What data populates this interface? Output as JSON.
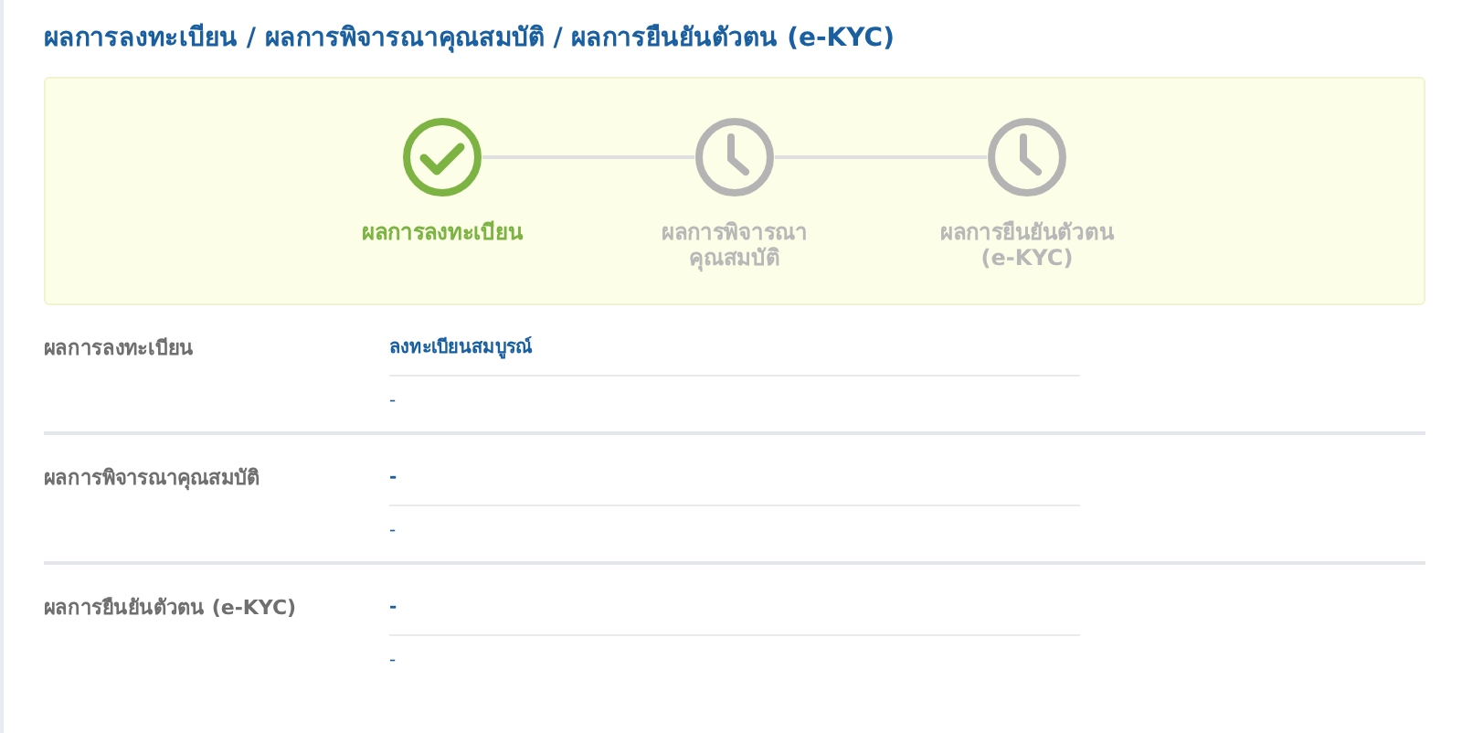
{
  "title": "ผลการลงทะเบียน / ผลการพิจารณาคุณสมบัติ / ผลการยืนยันตัวตน (e-KYC)",
  "steps": [
    {
      "label": "ผลการลงทะเบียน",
      "completed": true
    },
    {
      "label": "ผลการพิจารณา\nคุณสมบัติ",
      "completed": false
    },
    {
      "label": "ผลการยืนยันตัวตน\n(e-KYC)",
      "completed": false
    }
  ],
  "results": [
    {
      "label": "ผลการลงทะเบียน",
      "value": "ลงทะเบียนสมบูรณ์",
      "note": "-"
    },
    {
      "label": "ผลการพิจารณาคุณสมบัติ",
      "value": "-",
      "note": "-"
    },
    {
      "label": "ผลการยืนยันตัวตน (e-KYC)",
      "value": "-",
      "note": "-"
    }
  ]
}
